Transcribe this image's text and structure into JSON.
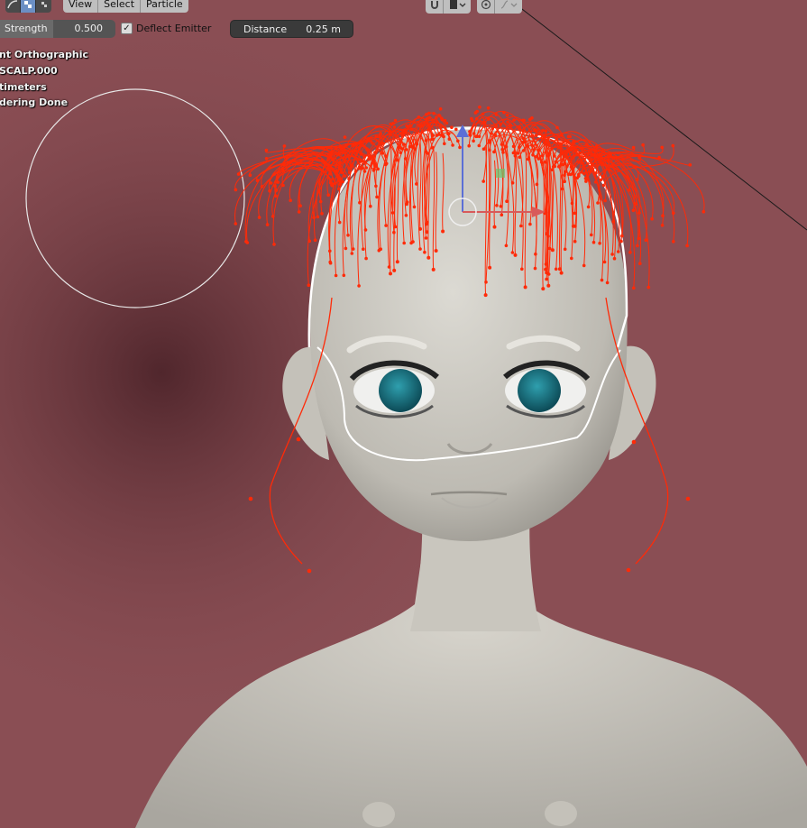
{
  "toolbar": {
    "view_label": "View",
    "select_label": "Select",
    "particle_label": "Particle",
    "tool_icons": [
      "comb-brush-icon",
      "checker-mode-icon",
      "checker-small-icon"
    ]
  },
  "brush": {
    "strength_label": "Strength",
    "strength_value": "0.500",
    "strength_fraction": 0.5,
    "deflect_label": "Deflect Emitter",
    "deflect_checked": true,
    "check_mark": "✓",
    "distance_label": "Distance",
    "distance_value": "0.25 m"
  },
  "overlay": {
    "line1": "nt Orthographic",
    "line2": "SCALP.000",
    "line3": "timeters",
    "line4": "dering Done"
  },
  "colors": {
    "background": "#8a4e54",
    "hair_strands": "#ff2a08",
    "toolbar_button": "#4a4a4a",
    "selected_curve": "#ffffff"
  },
  "header_icons": [
    "snap-magnet-icon",
    "display-mode-icon",
    "proportional-edit-icon",
    "falloff-icon"
  ]
}
